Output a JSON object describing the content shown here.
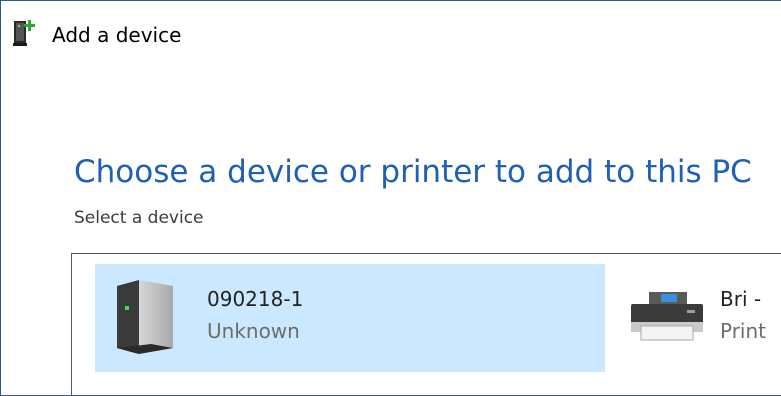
{
  "window": {
    "title": "Add a device",
    "title_icon": "add-device-icon"
  },
  "main": {
    "heading": "Choose a device or printer to add to this PC",
    "subheading": "Select a device"
  },
  "devices": [
    {
      "name": "090218-1",
      "status": "Unknown",
      "icon": "computer-tower-icon",
      "selected": true
    },
    {
      "name": "Bri -",
      "status": "Print",
      "icon": "printer-icon",
      "selected": false
    }
  ],
  "colors": {
    "accent": "#1f5fb4",
    "selection": "#cce8ff",
    "border": "#2b5797"
  }
}
